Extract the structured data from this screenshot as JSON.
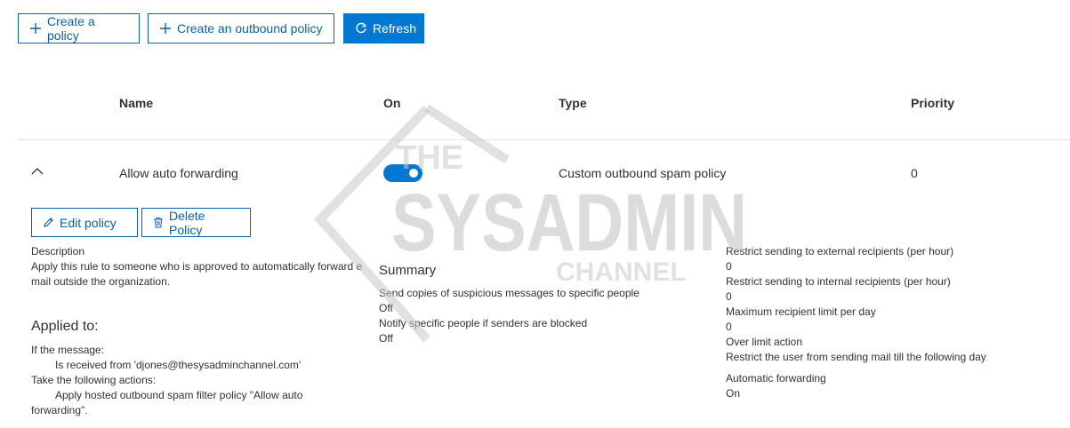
{
  "toolbar": {
    "create_policy": "Create a policy",
    "create_outbound": "Create an outbound policy",
    "refresh": "Refresh"
  },
  "table": {
    "headers": {
      "name": "Name",
      "on": "On",
      "type": "Type",
      "priority": "Priority"
    },
    "row": {
      "name": "Allow auto forwarding",
      "on": true,
      "type": "Custom outbound spam policy",
      "priority": "0"
    }
  },
  "details": {
    "edit_label": "Edit policy",
    "delete_label": "Delete Policy",
    "description_label": "Description",
    "description_text": "Apply this rule to someone who is approved to automatically forward e mail outside the organization.",
    "applied_to_heading": "Applied to:",
    "if_message": "If the message:",
    "received_from": "Is received from 'djones@thesysadminchannel.com'",
    "take_actions": "Take the following actions:",
    "apply_action_1": "Apply hosted outbound spam filter policy \"Allow auto",
    "apply_action_2": "forwarding\"."
  },
  "summary": {
    "heading": "Summary",
    "copies_label": "Send copies of suspicious messages to specific people",
    "copies_value": "Off",
    "notify_label": "Notify specific people if senders are blocked",
    "notify_value": "Off"
  },
  "limits": {
    "external_label": "Restrict sending to external recipients (per hour)",
    "external_value": "0",
    "internal_label": "Restrict sending to internal recipients (per hour)",
    "internal_value": "0",
    "max_label": "Maximum recipient limit per day",
    "max_value": "0",
    "over_label": "Over limit action",
    "over_value": "Restrict the user from sending mail till the following day",
    "auto_label": "Automatic forwarding",
    "auto_value": "On"
  },
  "watermark": {
    "line1": "THE",
    "line2": "SYSADMIN",
    "line3": "CHANNEL"
  },
  "colors": {
    "accent": "#0078d4",
    "text": "#323130",
    "divider": "#e1dfdd"
  },
  "icons": {
    "add": "add-icon",
    "refresh": "refresh-icon",
    "collapse": "chevron-up-icon",
    "edit": "pencil-icon",
    "delete": "trash-icon"
  }
}
